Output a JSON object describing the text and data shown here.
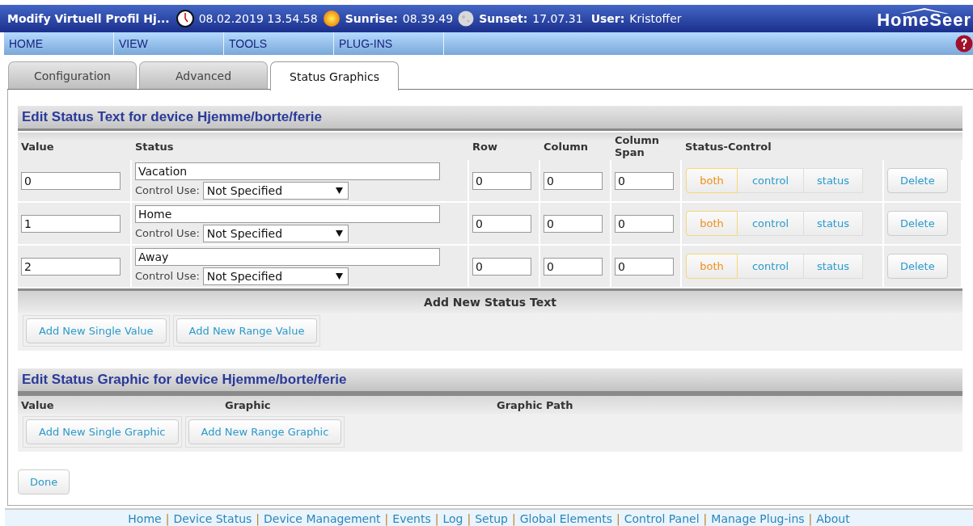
{
  "header": {
    "title": "Modify Virtuell Profil Hj...",
    "datetime": "08.02.2019 13.54.58",
    "sunrise_label": "Sunrise:",
    "sunrise": "08.39.49",
    "sunset_label": "Sunset:",
    "sunset": "17.07.31",
    "user_label": "User:",
    "user": "Kristoffer",
    "logo": "HomeSeer"
  },
  "menu": [
    "HOME",
    "VIEW",
    "TOOLS",
    "PLUG-INS"
  ],
  "tabs": [
    {
      "label": "Configuration",
      "selected": false
    },
    {
      "label": "Advanced",
      "selected": false
    },
    {
      "label": "Status Graphics",
      "selected": true
    }
  ],
  "status_text": {
    "title": "Edit Status Text for device Hjemme/borte/ferie",
    "columns": [
      "Value",
      "Status",
      "Row",
      "Column",
      "Column Span",
      "Status-Control"
    ],
    "rows": [
      {
        "value": "0",
        "status": "Vacation",
        "control_use_label": "Control Use:",
        "control_use": "Not Specified",
        "row": "0",
        "column": "0",
        "column_span": "0",
        "modes": [
          {
            "label": "both",
            "selected": true
          },
          {
            "label": "control",
            "selected": false
          },
          {
            "label": "status",
            "selected": false
          }
        ],
        "delete": "Delete"
      },
      {
        "value": "1",
        "status": "Home",
        "control_use_label": "Control Use:",
        "control_use": "Not Specified",
        "row": "0",
        "column": "0",
        "column_span": "0",
        "modes": [
          {
            "label": "both",
            "selected": true
          },
          {
            "label": "control",
            "selected": false
          },
          {
            "label": "status",
            "selected": false
          }
        ],
        "delete": "Delete"
      },
      {
        "value": "2",
        "status": "Away",
        "control_use_label": "Control Use:",
        "control_use": "Not Specified",
        "row": "0",
        "column": "0",
        "column_span": "0",
        "modes": [
          {
            "label": "both",
            "selected": true
          },
          {
            "label": "control",
            "selected": false
          },
          {
            "label": "status",
            "selected": false
          }
        ],
        "delete": "Delete"
      }
    ],
    "add_title": "Add New Status Text",
    "buttons": [
      "Add New Single Value",
      "Add New Range Value"
    ]
  },
  "status_graphic": {
    "title": "Edit Status Graphic for device Hjemme/borte/ferie",
    "columns": [
      "Value",
      "Graphic",
      "Graphic Path"
    ],
    "buttons": [
      "Add New Single Graphic",
      "Add New Range Graphic"
    ]
  },
  "done": "Done",
  "footer": {
    "separator": "|",
    "links": [
      "Home",
      "Device Status",
      "Device Management",
      "Events",
      "Log",
      "Setup",
      "Global Elements",
      "Control Panel",
      "Manage Plug-ins",
      "About"
    ]
  }
}
